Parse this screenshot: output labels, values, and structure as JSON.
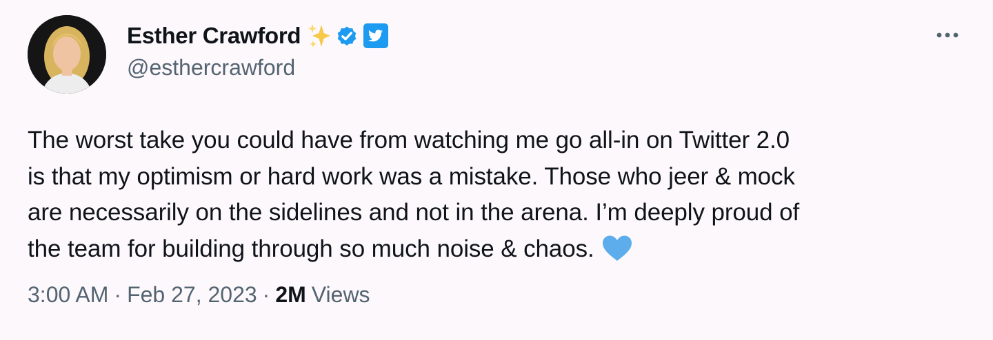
{
  "author": {
    "display_name": "Esther Crawford",
    "handle": "@esthercrawford",
    "badges": [
      "sparkles-icon",
      "verified-badge-icon",
      "twitter-bird-icon"
    ]
  },
  "tweet": {
    "lines": [
      "The worst take you could have from watching me go all-in on Twitter 2.0",
      "is that my optimism or hard work was a mistake. Those who jeer & mock",
      "are necessarily on the sidelines and not in the arena. I’m deeply proud of",
      "the team for building through so much noise & chaos."
    ],
    "emoji": "blue-heart-icon"
  },
  "meta": {
    "time": "3:00 AM",
    "separator": "·",
    "date": "Feb 27, 2023",
    "views_count": "2M",
    "views_label": "Views"
  },
  "colors": {
    "background": "#fdf8fc",
    "text": "#0f1419",
    "secondary_text": "#536471",
    "verified_blue": "#1d9bf0",
    "sparkle_yellow": "#f7c948",
    "heart_blue": "#5dadec"
  },
  "icons": {
    "more": "more-options-icon"
  }
}
